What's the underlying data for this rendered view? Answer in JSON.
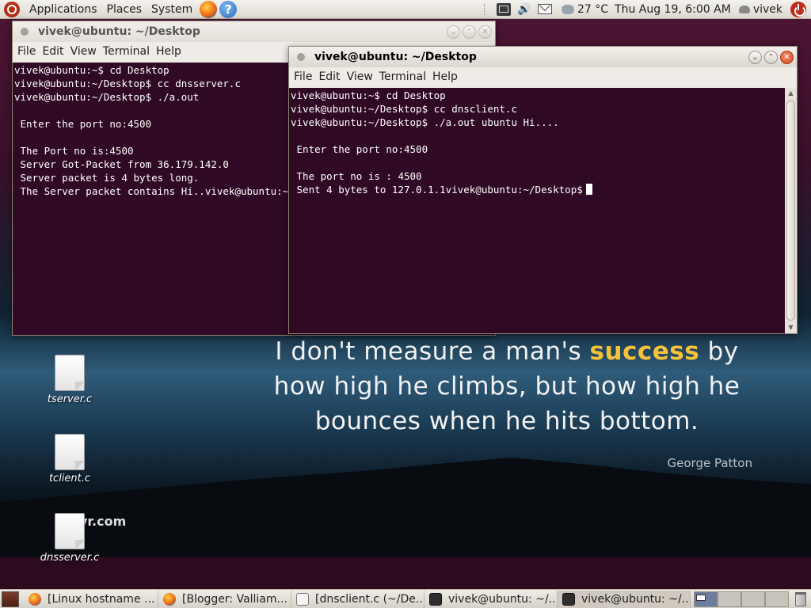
{
  "top_panel": {
    "menus": [
      "Applications",
      "Places",
      "System"
    ],
    "help_glyph": "?",
    "temperature": "27 °C",
    "datetime": "Thu Aug 19,  6:00 AM",
    "user": "vivek"
  },
  "desktop": {
    "quote_part1": "I don't measure a man's ",
    "quote_highlight": "success",
    "quote_part2": " by how high he climbs, but how high he bounces when he hits bottom.",
    "quote_author": "George Patton",
    "wallpaper_watermark": "yr.com",
    "icons": [
      {
        "label": "tserver.c"
      },
      {
        "label": "tclient.c"
      },
      {
        "label": "dnsserver.c"
      }
    ]
  },
  "windows": {
    "server": {
      "title": "vivek@ubuntu: ~/Desktop",
      "menu": [
        "File",
        "Edit",
        "View",
        "Terminal",
        "Help"
      ],
      "terminal_text": "vivek@ubuntu:~$ cd Desktop\nvivek@ubuntu:~/Desktop$ cc dnsserver.c\nvivek@ubuntu:~/Desktop$ ./a.out\n\n Enter the port no:4500\n\n The Port no is:4500\n Server Got-Packet from 36.179.142.0\n Server packet is 4 bytes long.\n The Server packet contains Hi..vivek@ubuntu:~/Desktop$ "
    },
    "client": {
      "title": "vivek@ubuntu: ~/Desktop",
      "menu": [
        "File",
        "Edit",
        "View",
        "Terminal",
        "Help"
      ],
      "terminal_text": "vivek@ubuntu:~$ cd Desktop\nvivek@ubuntu:~/Desktop$ cc dnsclient.c\nvivek@ubuntu:~/Desktop$ ./a.out ubuntu Hi....\n\n Enter the port no:4500\n\n The port no is : 4500\n Sent 4 bytes to 127.0.1.1vivek@ubuntu:~/Desktop$"
    }
  },
  "taskbar": {
    "tasks": [
      {
        "label": "[Linux hostname ...",
        "icon": "firefox-icon"
      },
      {
        "label": "[Blogger: Valliam...",
        "icon": "firefox-icon"
      },
      {
        "label": "[dnsclient.c (~/De...",
        "icon": "text-editor-icon"
      },
      {
        "label": "vivek@ubuntu: ~/...",
        "icon": "terminal-icon"
      },
      {
        "label": "vivek@ubuntu: ~/...",
        "icon": "terminal-icon"
      }
    ]
  },
  "colors": {
    "terminal_bg": "#300a24",
    "highlight": "#f6c23a"
  }
}
